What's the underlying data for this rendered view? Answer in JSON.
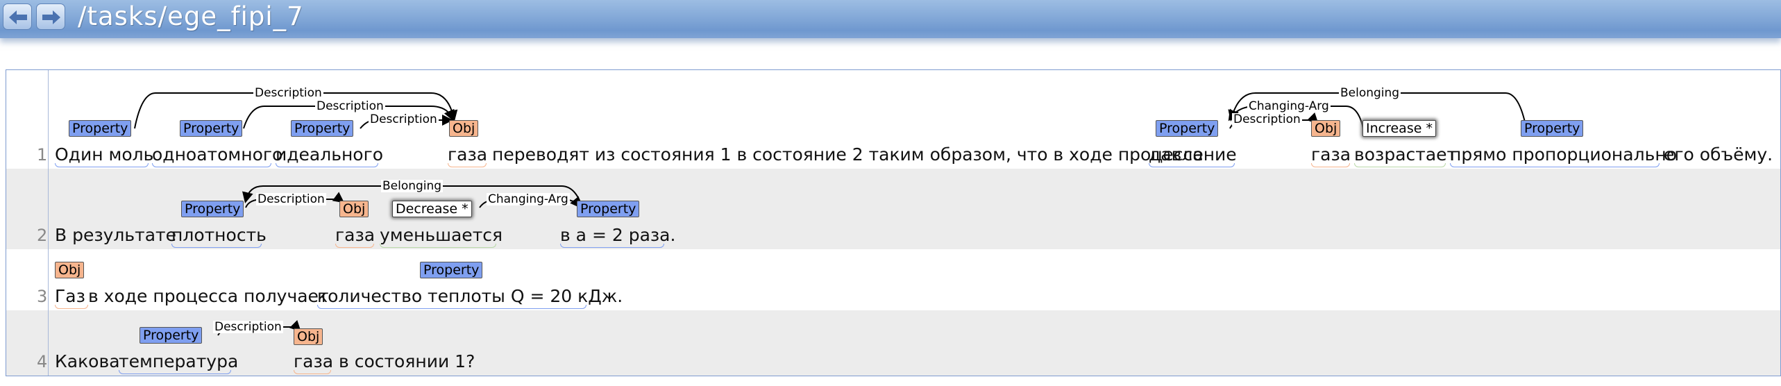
{
  "nav": {
    "back_icon": "arrow-left-icon",
    "forward_icon": "arrow-right-icon",
    "path": "/tasks/ege_fipi_7"
  },
  "labels": {
    "property": "Property",
    "obj": "Obj",
    "increase": "Increase *",
    "decrease": "Decrease *"
  },
  "relations": {
    "description": "Description",
    "belonging": "Belonging",
    "changing_arg": "Changing-Arg"
  },
  "colors": {
    "property": "#7f9ff0",
    "obj": "#f6b58e",
    "header": "#84a9d8"
  },
  "sentences": [
    {
      "num": "1",
      "tokens": [
        "Один моль",
        "одноатомного",
        "идеального",
        "газа",
        "переводят из состояния 1 в состояние 2 таким образом, что в ходе процесса",
        "давление",
        "газа",
        "возрастает",
        "прямо пропорционально",
        "его объёму."
      ]
    },
    {
      "num": "2",
      "tokens": [
        "В результате",
        "плотность",
        "газа",
        "уменьшается",
        "в a = 2 раза."
      ]
    },
    {
      "num": "3",
      "tokens": [
        "Газ",
        "в ходе процесса получает",
        "количество теплоты Q = 20 кДж."
      ]
    },
    {
      "num": "4",
      "tokens": [
        "Какова",
        "температура",
        "газа в состоянии 1?"
      ]
    }
  ]
}
